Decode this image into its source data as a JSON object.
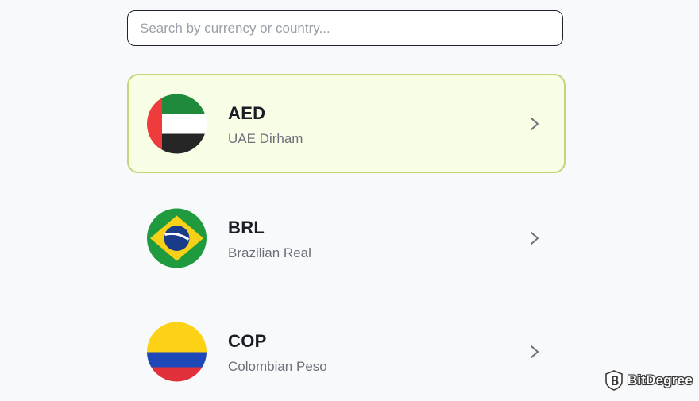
{
  "search": {
    "placeholder": "Search by currency or country...",
    "value": ""
  },
  "currencies": [
    {
      "code": "AED",
      "name": "UAE Dirham",
      "flag_icon": "uae-flag-icon",
      "selected": true
    },
    {
      "code": "BRL",
      "name": "Brazilian Real",
      "flag_icon": "brazil-flag-icon",
      "selected": false
    },
    {
      "code": "COP",
      "name": "Colombian Peso",
      "flag_icon": "colombia-flag-icon",
      "selected": false
    }
  ],
  "colors": {
    "selected_border": "#c4d47a",
    "selected_background": "#f8fde6",
    "page_background": "#f8f9fb",
    "code_text": "#1a1d24",
    "name_text": "#6b7079"
  },
  "watermark": {
    "text": "BitDegree",
    "icon": "bitdegree-logo-icon"
  }
}
